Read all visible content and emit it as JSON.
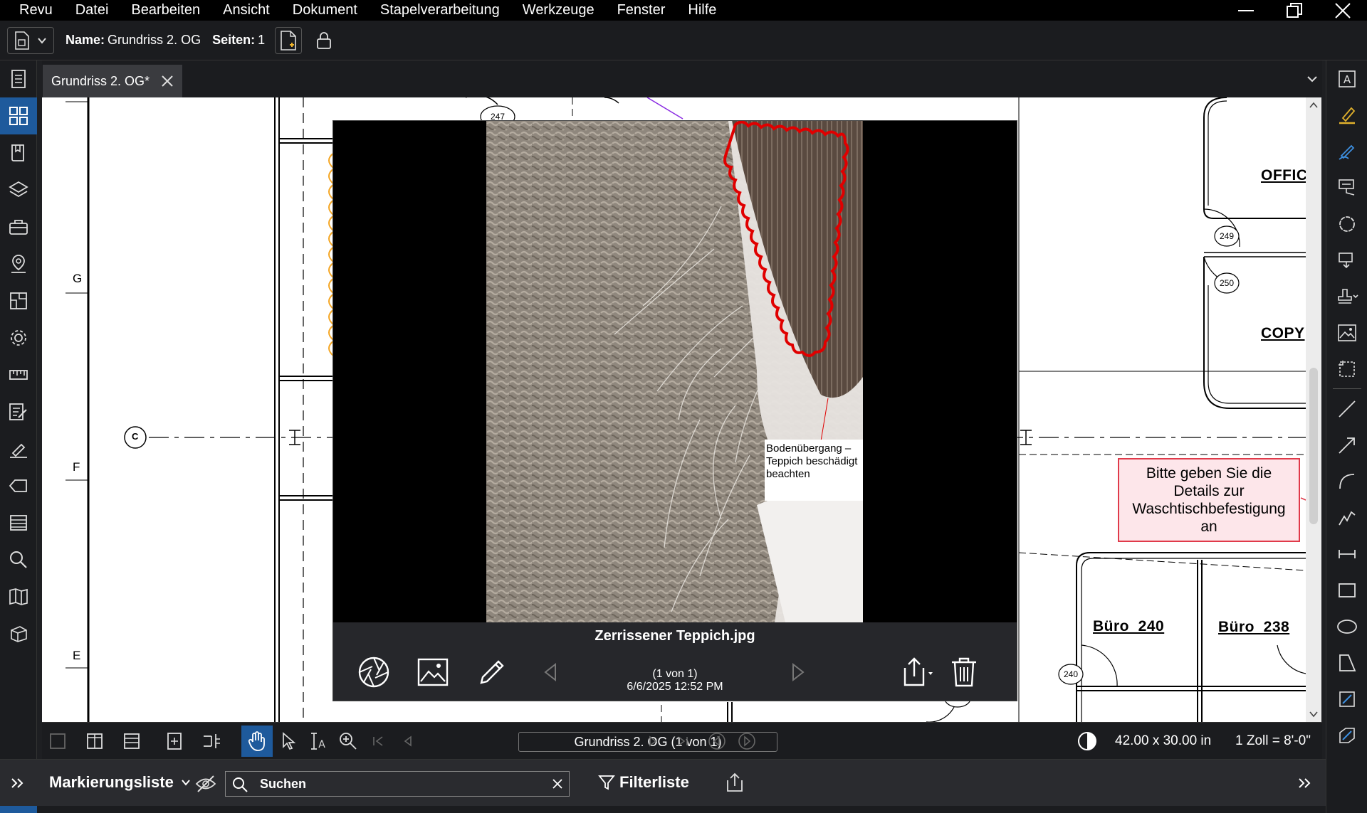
{
  "menubar": {
    "items": [
      "Revu",
      "Datei",
      "Bearbeiten",
      "Ansicht",
      "Dokument",
      "Stapelverarbeitung",
      "Werkzeuge",
      "Fenster",
      "Hilfe"
    ]
  },
  "properties": {
    "name_label": "Name:",
    "name_value": "Grundriss 2. OG",
    "pages_label": "Seiten:",
    "pages_value": "1"
  },
  "tab": {
    "label": "Grundriss 2. OG*"
  },
  "drawing": {
    "grid_labels": [
      "G",
      "F",
      "E"
    ],
    "grid_bubble": "C",
    "rooms": [
      "OFFICE",
      "COPY",
      "Büro  240",
      "Büro  238"
    ],
    "tags": [
      "247",
      "249",
      "250",
      "240"
    ],
    "callout": "Bitte geben Sie die Details zur Waschtischbefestigung an"
  },
  "viewer": {
    "note": "Bodenübergang – Teppich beschädigt beachten",
    "filename": "Zerrissener Teppich.jpg",
    "page_count": "(1 von 1)",
    "timestamp": "6/6/2025 12:52 PM"
  },
  "navbar": {
    "page_box": "Grundriss 2. OG (1 von 1)",
    "dimensions": "42.00 x 30.00 in",
    "scale": "1 Zoll = 8'-0\""
  },
  "panel": {
    "title": "Markierungsliste",
    "search_placeholder": "Suchen",
    "filter": "Filterliste"
  },
  "colors": {
    "accent": "#1e5a9c",
    "callout_border": "#e03a4a",
    "callout_fill": "#fde6ea",
    "cloud_red": "#e00000",
    "cloud_orange": "#f5a623"
  }
}
